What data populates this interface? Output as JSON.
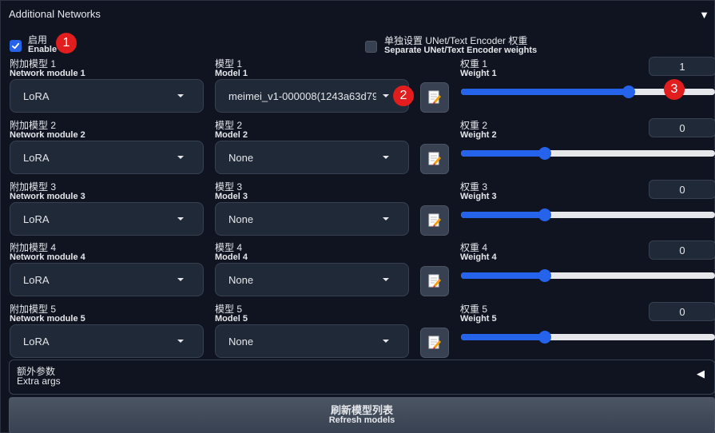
{
  "panel": {
    "title": "Additional Networks",
    "collapse_icon": "▼"
  },
  "enable": {
    "label_cn": "启用",
    "label_en": "Enable",
    "checked": true
  },
  "separate_weights": {
    "label_cn": "单独设置 UNet/Text Encoder 权重",
    "label_en": "Separate UNet/Text Encoder weights",
    "checked": false
  },
  "rows": [
    {
      "module_label_cn": "附加模型 1",
      "module_label_en": "Network module 1",
      "module_value": "LoRA",
      "model_label_cn": "模型 1",
      "model_label_en": "Model 1",
      "model_value": "meimei_v1-000008(1243a63d79",
      "weight_label_cn": "权重 1",
      "weight_label_en": "Weight 1",
      "weight_value": "1",
      "weight_fraction": 0.66
    },
    {
      "module_label_cn": "附加模型 2",
      "module_label_en": "Network module 2",
      "module_value": "LoRA",
      "model_label_cn": "模型 2",
      "model_label_en": "Model 2",
      "model_value": "None",
      "weight_label_cn": "权重 2",
      "weight_label_en": "Weight 2",
      "weight_value": "0",
      "weight_fraction": 0.33
    },
    {
      "module_label_cn": "附加模型 3",
      "module_label_en": "Network module 3",
      "module_value": "LoRA",
      "model_label_cn": "模型 3",
      "model_label_en": "Model 3",
      "model_value": "None",
      "weight_label_cn": "权重 3",
      "weight_label_en": "Weight 3",
      "weight_value": "0",
      "weight_fraction": 0.33
    },
    {
      "module_label_cn": "附加模型 4",
      "module_label_en": "Network module 4",
      "module_value": "LoRA",
      "model_label_cn": "模型 4",
      "model_label_en": "Model 4",
      "model_value": "None",
      "weight_label_cn": "权重 4",
      "weight_label_en": "Weight 4",
      "weight_value": "0",
      "weight_fraction": 0.33
    },
    {
      "module_label_cn": "附加模型 5",
      "module_label_en": "Network module 5",
      "module_value": "LoRA",
      "model_label_cn": "模型 5",
      "model_label_en": "Model 5",
      "model_value": "None",
      "weight_label_cn": "权重 5",
      "weight_label_en": "Weight 5",
      "weight_value": "0",
      "weight_fraction": 0.33
    }
  ],
  "extra_args": {
    "label_cn": "额外参数",
    "label_en": "Extra args",
    "toggle_icon": "◀"
  },
  "refresh": {
    "label_cn": "刷新模型列表",
    "label_en": "Refresh models"
  },
  "markers": [
    "1",
    "2",
    "3"
  ],
  "colors": {
    "accent": "#2563eb",
    "background": "#0b0f19",
    "input_bg": "#1f2937",
    "marker": "#e11d1d"
  }
}
